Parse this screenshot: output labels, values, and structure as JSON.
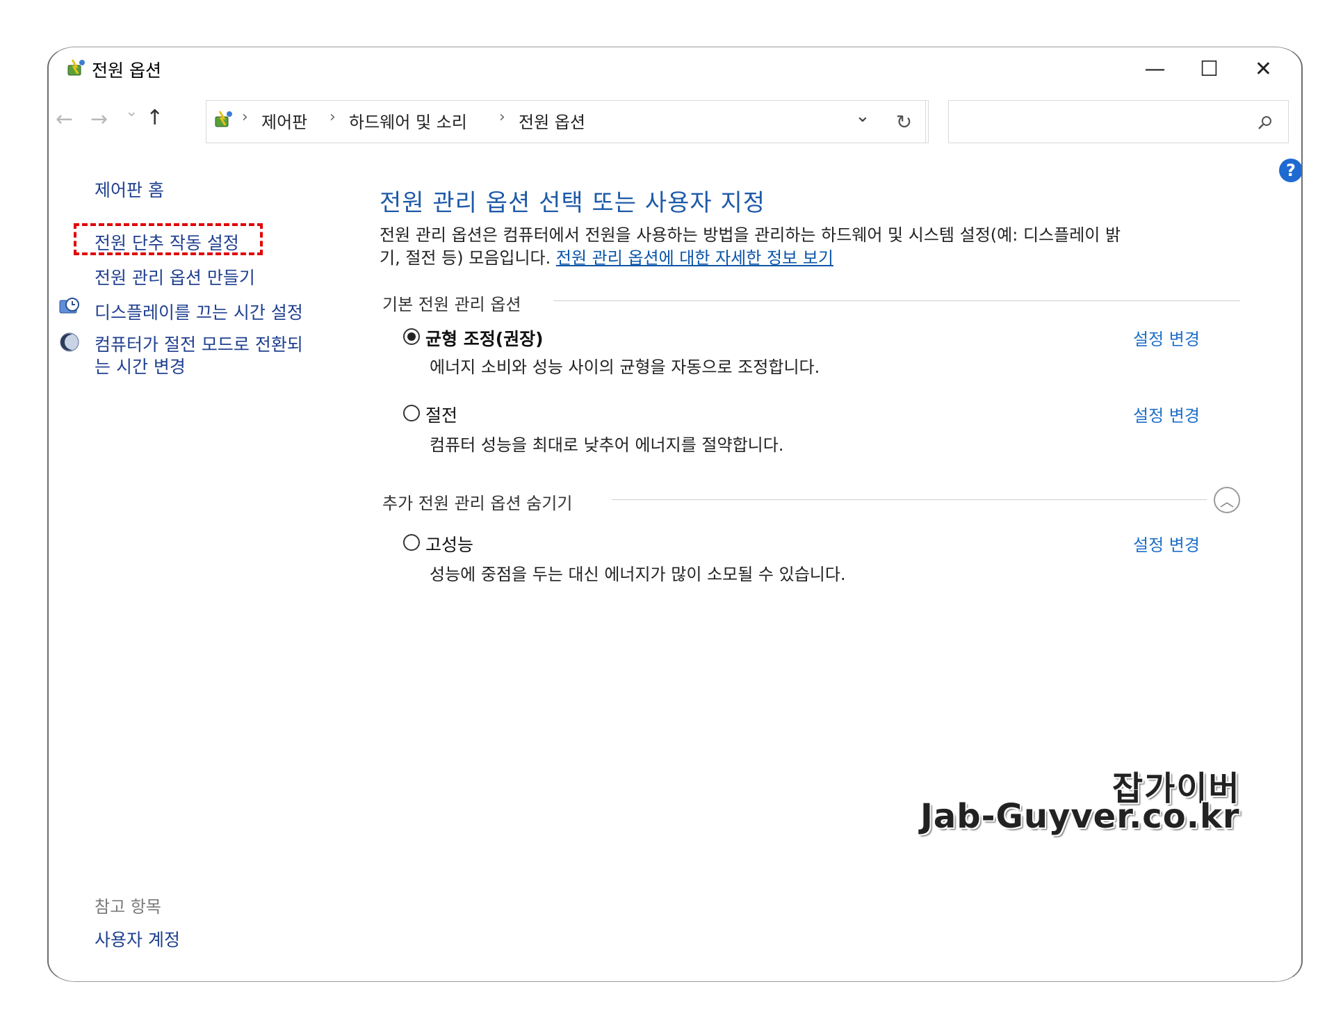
{
  "window": {
    "title": "전원 옵션",
    "controls": {
      "minimize": "—",
      "maximize": "☐",
      "close": "✕"
    }
  },
  "nav": {
    "back": "←",
    "forward": "→",
    "recent": "⌄",
    "up": "↑"
  },
  "breadcrumb": [
    "제어판",
    "하드웨어 및 소리",
    "전원 옵션"
  ],
  "breadcrumb_separator": "›",
  "address_dropdown": "⌄",
  "refresh": "↻",
  "search": {
    "placeholder": "",
    "icon": "search-icon"
  },
  "sidebar": {
    "home": "제어판 홈",
    "links": [
      "전원 단추 작동 설정",
      "전원 관리 옵션 만들기",
      "디스플레이를 끄는 시간 설정",
      "컴퓨터가 절전 모드로 전환되는 시간 변경"
    ],
    "see_also_label": "참고 항목",
    "see_also_links": [
      "사용자 계정"
    ]
  },
  "main": {
    "heading": "전원 관리 옵션 선택 또는 사용자 지정",
    "description_line1": "전원 관리 옵션은 컴퓨터에서 전원을 사용하는 방법을 관리하는 하드웨어 및 시스템 설정(예: 디스플레이 밝",
    "description_line2": "기, 절전 등) 모음입니다. ",
    "description_link": "전원 관리 옵션에 대한 자세한 정보 보기",
    "basic_section": "기본 전원 관리 옵션",
    "extra_section": "추가 전원 관리 옵션 숨기기",
    "change_label": "설정 변경",
    "plans": [
      {
        "name": "균형 조정(권장)",
        "desc": "에너지 소비와 성능 사이의 균형을 자동으로 조정합니다.",
        "selected": true
      },
      {
        "name": "절전",
        "desc": "컴퓨터 성능을 최대로 낮추어 에너지를 절약합니다.",
        "selected": false
      },
      {
        "name": "고성능",
        "desc": "성능에 중점을 두는 대신 에너지가 많이 소모될 수 있습니다.",
        "selected": false
      }
    ]
  },
  "help": "?",
  "watermark": {
    "line1": "잡가이버",
    "line2": "Jab-Guyver.co.kr"
  },
  "colors": {
    "highlight": "#e00000",
    "link": "#1e5aa8",
    "help": "#1f6ad1"
  }
}
